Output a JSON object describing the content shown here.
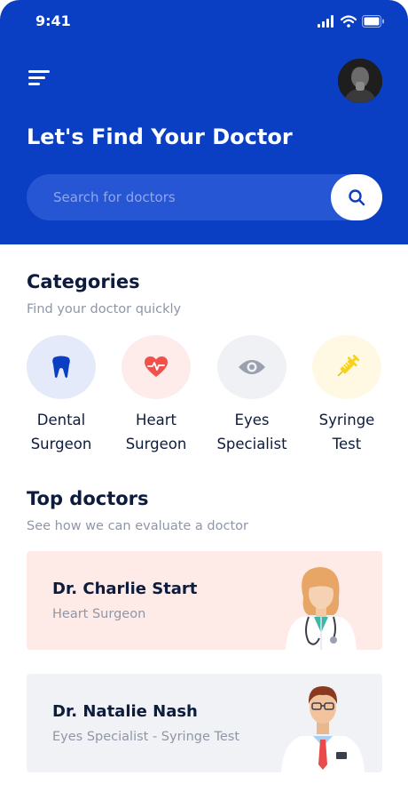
{
  "status": {
    "time": "9:41"
  },
  "header": {
    "title": "Let's Find Your Doctor",
    "search_placeholder": "Search for doctors"
  },
  "categories": {
    "title": "Categories",
    "subtitle": "Find your doctor quickly",
    "items": [
      {
        "line1": "Dental",
        "line2": "Surgeon",
        "icon": "tooth-icon",
        "bg": "#e4eaf9",
        "color": "#0a3fc4"
      },
      {
        "line1": "Heart",
        "line2": "Surgeon",
        "icon": "heart-icon",
        "bg": "#fdecea",
        "color": "#f2504b"
      },
      {
        "line1": "Eyes",
        "line2": "Specialist",
        "icon": "eye-icon",
        "bg": "#f0f1f5",
        "color": "#9aa0ad"
      },
      {
        "line1": "Syringe",
        "line2": "Test",
        "icon": "syringe-icon",
        "bg": "#fff9e3",
        "color": "#f6d21e"
      }
    ]
  },
  "top_doctors": {
    "title": "Top doctors",
    "subtitle": "See how we can evaluate a doctor",
    "doctors": [
      {
        "name": "Dr. Charlie Start",
        "specialty": "Heart Surgeon",
        "bg": "#feebe8"
      },
      {
        "name": "Dr. Natalie Nash",
        "specialty": "Eyes Specialist - Syringe Test",
        "bg": "#f1f2f6"
      }
    ]
  },
  "colors": {
    "primary": "#0a3fc4",
    "text": "#0d1b3d",
    "muted": "#8e96a8"
  }
}
